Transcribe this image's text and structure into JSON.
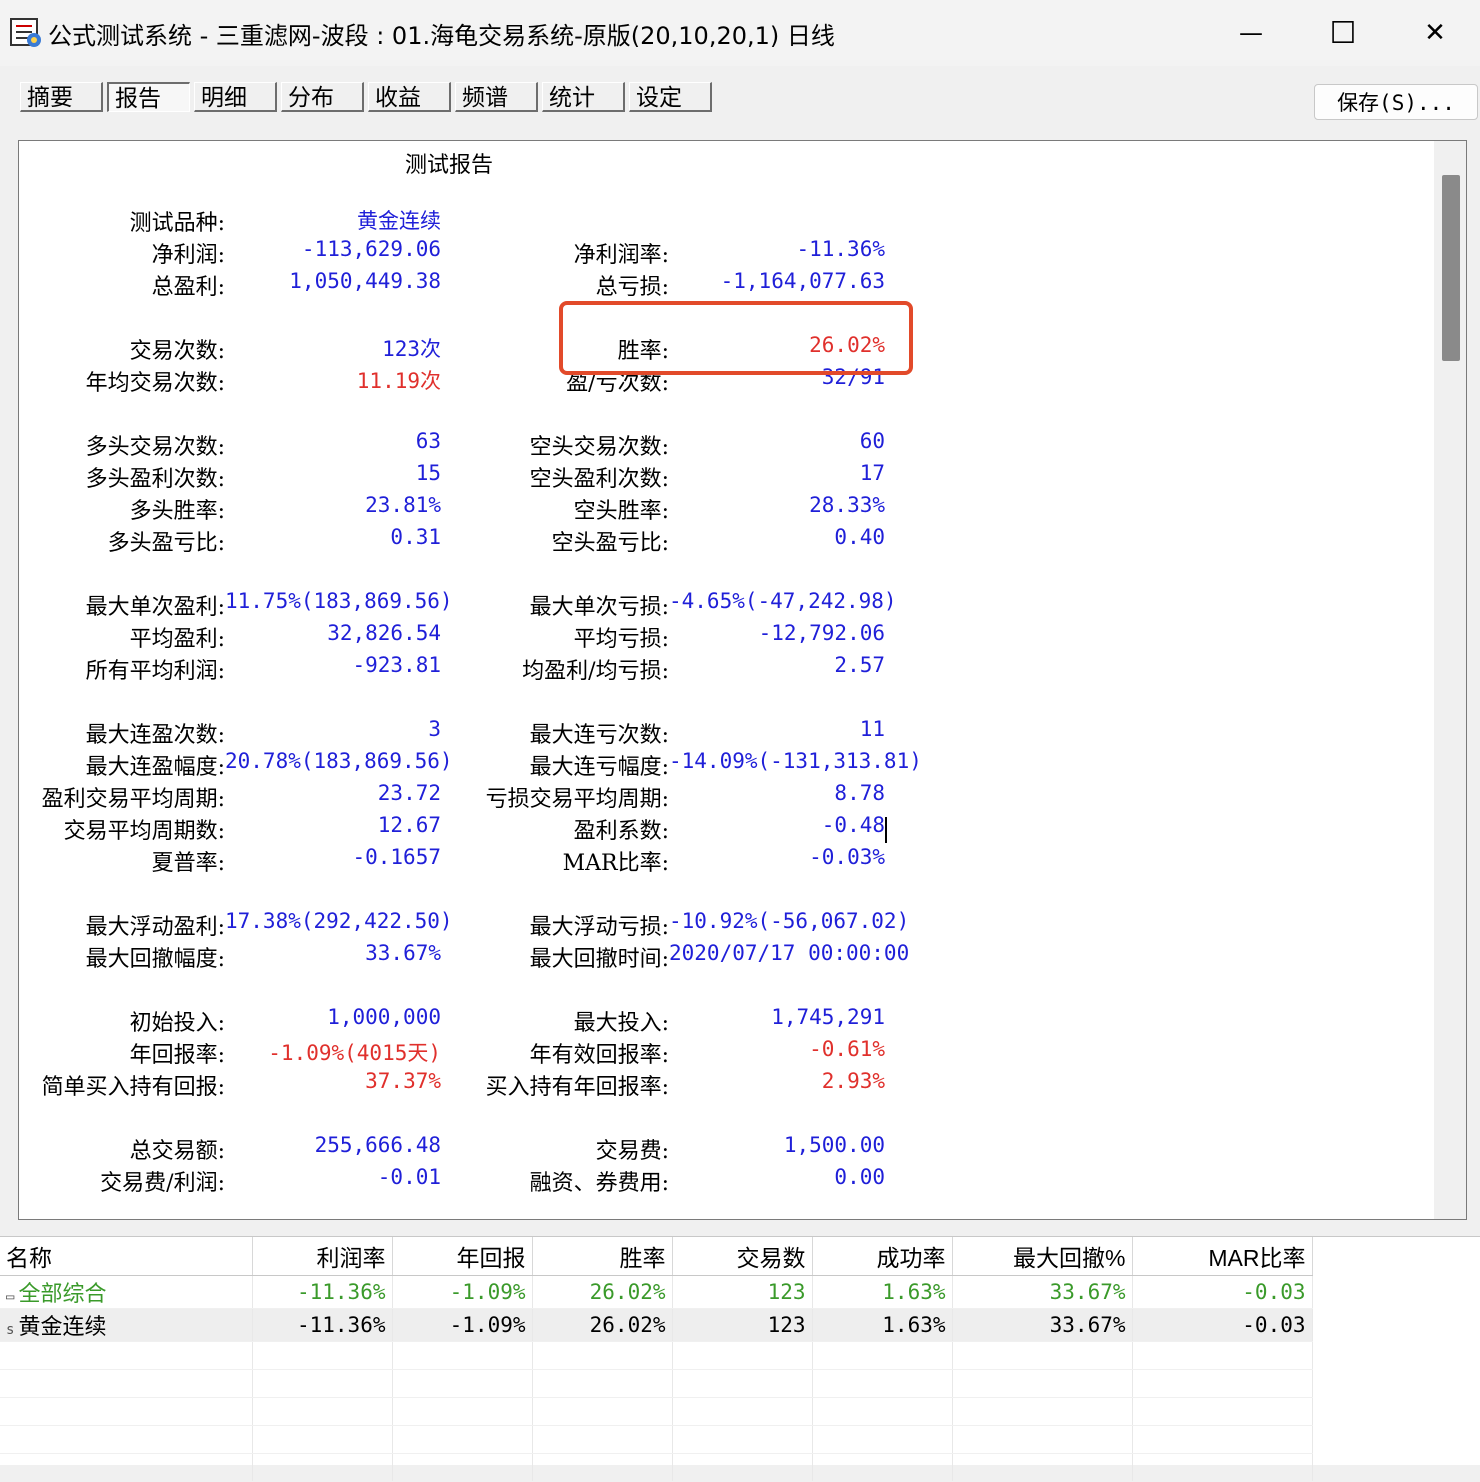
{
  "window": {
    "title": "公式测试系统 - 三重滤网-波段 : 01.海龟交易系统-原版(20,10,20,1) 日线",
    "minimize_glyph": "—",
    "maximize_glyph": "☐",
    "close_glyph": "✕"
  },
  "tabs": [
    "摘要",
    "报告",
    "明细",
    "分布",
    "收益",
    "频谱",
    "统计",
    "设定"
  ],
  "active_tab": "报告",
  "save_button": "保存(S)...",
  "report": {
    "title": "测试报告",
    "rows": [
      {
        "l1": "测试品种:",
        "v1": "黄金连续",
        "c1": "blue"
      },
      {
        "l1": "净利润:",
        "v1": "-113,629.06",
        "c1": "blue",
        "l2": "净利润率:",
        "v2": "-11.36%",
        "c2": "blue"
      },
      {
        "l1": "总盈利:",
        "v1": "1,050,449.38",
        "c1": "blue",
        "l2": "总亏损:",
        "v2": "-1,164,077.63",
        "c2": "blue"
      },
      {
        "l1": "交易次数:",
        "v1": "123次",
        "c1": "blue",
        "l2": "胜率:",
        "v2": "26.02%",
        "c2": "red"
      },
      {
        "l1": "年均交易次数:",
        "v1": "11.19次",
        "c1": "red",
        "l2": "盈/亏次数:",
        "v2": "32/91",
        "c2": "blue"
      },
      {
        "l1": "多头交易次数:",
        "v1": "63",
        "c1": "blue",
        "l2": "空头交易次数:",
        "v2": "60",
        "c2": "blue"
      },
      {
        "l1": "多头盈利次数:",
        "v1": "15",
        "c1": "blue",
        "l2": "空头盈利次数:",
        "v2": "17",
        "c2": "blue"
      },
      {
        "l1": "多头胜率:",
        "v1": "23.81%",
        "c1": "blue",
        "l2": "空头胜率:",
        "v2": "28.33%",
        "c2": "blue"
      },
      {
        "l1": "多头盈亏比:",
        "v1": "0.31",
        "c1": "blue",
        "l2": "空头盈亏比:",
        "v2": "0.40",
        "c2": "blue"
      },
      {
        "l1": "最大单次盈利:",
        "v1": "11.75%(183,869.56)",
        "c1": "blue",
        "l2": "最大单次亏损:",
        "v2": "-4.65%(-47,242.98)",
        "c2": "blue"
      },
      {
        "l1": "平均盈利:",
        "v1": "32,826.54",
        "c1": "blue",
        "l2": "平均亏损:",
        "v2": "-12,792.06",
        "c2": "blue"
      },
      {
        "l1": "所有平均利润:",
        "v1": "-923.81",
        "c1": "blue",
        "l2": "均盈利/均亏损:",
        "v2": "2.57",
        "c2": "blue"
      },
      {
        "l1": "最大连盈次数:",
        "v1": "3",
        "c1": "blue",
        "l2": "最大连亏次数:",
        "v2": "11",
        "c2": "blue"
      },
      {
        "l1": "最大连盈幅度:",
        "v1": "20.78%(183,869.56)",
        "c1": "blue",
        "l2": "最大连亏幅度:",
        "v2": "-14.09%(-131,313.81)",
        "c2": "blue"
      },
      {
        "l1": "盈利交易平均周期:",
        "v1": "23.72",
        "c1": "blue",
        "l2": "亏损交易平均周期:",
        "v2": "8.78",
        "c2": "blue"
      },
      {
        "l1": "交易平均周期数:",
        "v1": "12.67",
        "c1": "blue",
        "l2": "盈利系数:",
        "v2": "-0.48",
        "c2": "blue"
      },
      {
        "l1": "夏普率:",
        "v1": "-0.1657",
        "c1": "blue",
        "l2": "MAR比率:",
        "v2": "-0.03%",
        "c2": "blue"
      },
      {
        "l1": "最大浮动盈利:",
        "v1": "17.38%(292,422.50)",
        "c1": "blue",
        "l2": "最大浮动亏损:",
        "v2": "-10.92%(-56,067.02)",
        "c2": "blue"
      },
      {
        "l1": "最大回撤幅度:",
        "v1": "33.67%",
        "c1": "blue",
        "l2": "最大回撤时间:",
        "v2": "2020/07/17 00:00:00",
        "c2": "blue"
      },
      {
        "l1": "初始投入:",
        "v1": "1,000,000",
        "c1": "blue",
        "l2": "最大投入:",
        "v2": "1,745,291",
        "c2": "blue"
      },
      {
        "l1": "年回报率:",
        "v1": "-1.09%(4015天)",
        "c1": "red",
        "l2": "年有效回报率:",
        "v2": "-0.61%",
        "c2": "red"
      },
      {
        "l1": "简单买入持有回报:",
        "v1": "37.37%",
        "c1": "red",
        "l2": "买入持有年回报率:",
        "v2": "2.93%",
        "c2": "red"
      },
      {
        "l1": "总交易额:",
        "v1": "255,666.48",
        "c1": "blue",
        "l2": "交易费:",
        "v2": "1,500.00",
        "c2": "blue"
      },
      {
        "l1": "交易费/利润:",
        "v1": "-0.01",
        "c1": "blue",
        "l2": "融资、券费用:",
        "v2": "0.00",
        "c2": "blue"
      }
    ]
  },
  "summary_table": {
    "headers": [
      "名称",
      "利润率",
      "年回报",
      "胜率",
      "交易数",
      "成功率",
      "最大回撤%",
      "MAR比率"
    ],
    "rows": [
      {
        "icon": "folder-icon",
        "cells": [
          "全部综合",
          "-11.36%",
          "-1.09%",
          "26.02%",
          "123",
          "1.63%",
          "33.67%",
          "-0.03"
        ],
        "color": "#3a9a2a"
      },
      {
        "icon": "s",
        "cells": [
          "黄金连续",
          "-11.36%",
          "-1.09%",
          "26.02%",
          "123",
          "1.63%",
          "33.67%",
          "-0.03"
        ],
        "color": "#000000"
      }
    ]
  }
}
